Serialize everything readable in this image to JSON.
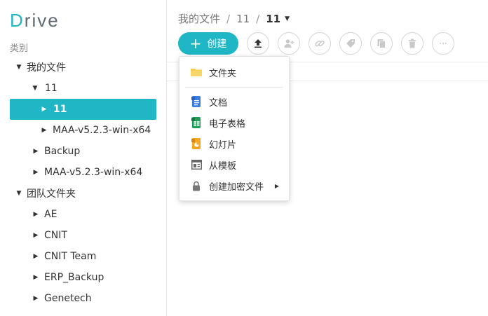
{
  "logo": {
    "first": "D",
    "rest": "rive"
  },
  "sidebar": {
    "section_title": "类别",
    "items": [
      {
        "label": "我的文件",
        "caret": "▼"
      },
      {
        "label": "11",
        "caret": "▼"
      },
      {
        "label": "11",
        "caret": "▶"
      },
      {
        "label": "MAA-v5.2.3-win-x64",
        "caret": "▶"
      },
      {
        "label": "Backup",
        "caret": "▶"
      },
      {
        "label": "MAA-v5.2.3-win-x64",
        "caret": "▶"
      },
      {
        "label": "团队文件夹",
        "caret": "▼"
      },
      {
        "label": "AE",
        "caret": "▶"
      },
      {
        "label": "CNIT",
        "caret": "▶"
      },
      {
        "label": "CNIT Team",
        "caret": "▶"
      },
      {
        "label": "ERP_Backup",
        "caret": "▶"
      },
      {
        "label": "Genetech",
        "caret": "▶"
      }
    ]
  },
  "breadcrumb": {
    "root": "我的文件",
    "sep": "/",
    "level1": "11",
    "current": "11",
    "dropdown": "▼"
  },
  "toolbar": {
    "create_plus": "+",
    "create_label": "创建",
    "more": "···"
  },
  "menu": {
    "items": [
      {
        "label": "文件夹",
        "icon": "folder-icon"
      },
      {
        "label": "文档",
        "icon": "document-icon"
      },
      {
        "label": "电子表格",
        "icon": "spreadsheet-icon"
      },
      {
        "label": "幻灯片",
        "icon": "slides-icon"
      },
      {
        "label": "从模板",
        "icon": "template-icon"
      },
      {
        "label": "创建加密文件",
        "icon": "lock-icon"
      }
    ],
    "submenu_arrow": "▶"
  },
  "colors": {
    "accent": "#1fb6c6",
    "folder": "#f7c948",
    "doc": "#3b7ddd",
    "sheet": "#1e9e57",
    "slides": "#f5a623"
  }
}
